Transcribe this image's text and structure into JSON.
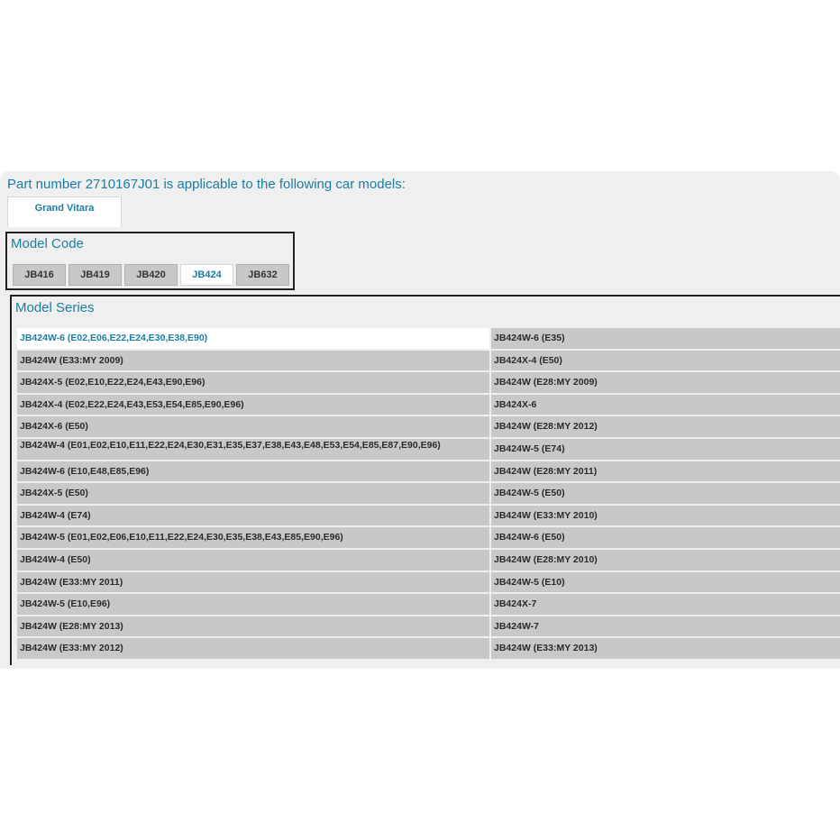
{
  "heading": "Part number 2710167J01 is applicable to the following car models:",
  "car_model_tab": "Grand Vitara",
  "model_code": {
    "title": "Model Code",
    "tabs": [
      "JB416",
      "JB419",
      "JB420",
      "JB424",
      "JB632"
    ],
    "active": "JB424"
  },
  "model_series": {
    "title": "Model Series",
    "selected": "JB424W-6 (E02,E06,E22,E24,E30,E38,E90)",
    "rows": [
      [
        "JB424W-6 (E02,E06,E22,E24,E30,E38,E90)",
        "JB424W-6 (E35)"
      ],
      [
        "JB424W (E33:MY 2009)",
        "JB424X-4 (E50)"
      ],
      [
        "JB424X-5 (E02,E10,E22,E24,E43,E90,E96)",
        "JB424W (E28:MY 2009)"
      ],
      [
        "JB424X-4 (E02,E22,E24,E43,E53,E54,E85,E90,E96)",
        "JB424X-6"
      ],
      [
        "JB424X-6 (E50)",
        "JB424W (E28:MY 2012)"
      ],
      [
        "JB424W-4 (E01,E02,E10,E11,E22,E24,E30,E31,E35,E37,E38,E43,E48,E53,E54,E85,E87,E90,E96)",
        "JB424W-5 (E74)"
      ],
      [
        "JB424W-6 (E10,E48,E85,E96)",
        "JB424W (E28:MY 2011)"
      ],
      [
        "JB424X-5 (E50)",
        "JB424W-5 (E50)"
      ],
      [
        "JB424W-4 (E74)",
        "JB424W (E33:MY 2010)"
      ],
      [
        "JB424W-5 (E01,E02,E06,E10,E11,E22,E24,E30,E35,E38,E43,E85,E90,E96)",
        "JB424W-6 (E50)"
      ],
      [
        "JB424W-4 (E50)",
        "JB424W (E28:MY 2010)"
      ],
      [
        "JB424W (E33:MY 2011)",
        "JB424W-5 (E10)"
      ],
      [
        "JB424W-5 (E10,E96)",
        "JB424X-7"
      ],
      [
        "JB424W (E28:MY 2013)",
        "JB424W-7"
      ],
      [
        "JB424W (E33:MY 2012)",
        "JB424W (E33:MY 2013)"
      ]
    ]
  },
  "colors": {
    "accent": "#1a7ea3",
    "panel_bg": "#efefef",
    "cell_bg": "#c8c8c8"
  }
}
